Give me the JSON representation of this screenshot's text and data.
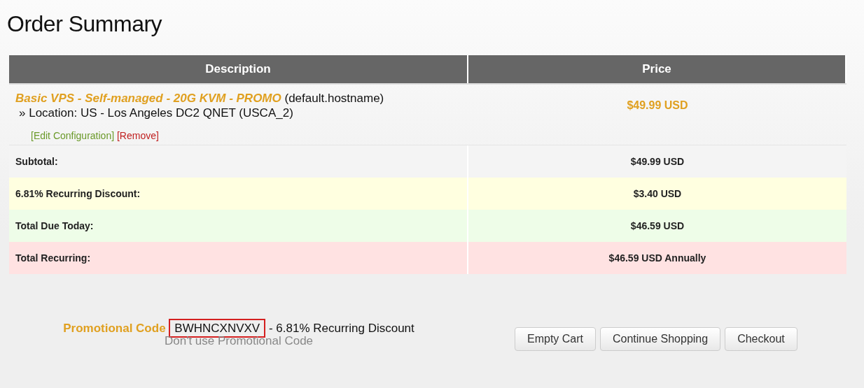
{
  "page_title": "Order Summary",
  "table": {
    "columns": [
      "Description",
      "Price"
    ],
    "items": [
      {
        "product": "Basic VPS - Self-managed - 20G KVM - PROMO",
        "hostname": "(default.hostname)",
        "option": "» Location: US - Los Angeles DC2 QNET (USCA_2)",
        "price": "$49.99 USD",
        "edit_link": "[Edit Configuration]",
        "remove_link": "[Remove]"
      }
    ],
    "summary": [
      {
        "kind": "subtotal",
        "label": "Subtotal:",
        "value": "$49.99 USD"
      },
      {
        "kind": "discount",
        "label": "6.81% Recurring Discount:",
        "value": "$3.40 USD"
      },
      {
        "kind": "due",
        "label": "Total Due Today:",
        "value": "$46.59 USD"
      },
      {
        "kind": "recurring",
        "label": "Total Recurring:",
        "value": "$46.59 USD Annually"
      }
    ]
  },
  "promo": {
    "label": "Promotional Code",
    "code": "BWHNCXNVXV",
    "highlighted": true,
    "description": "- 6.81% Recurring Discount",
    "remove_link": "Don't use Promotional Code"
  },
  "buttons": [
    "Empty Cart",
    "Continue Shopping",
    "Checkout"
  ]
}
